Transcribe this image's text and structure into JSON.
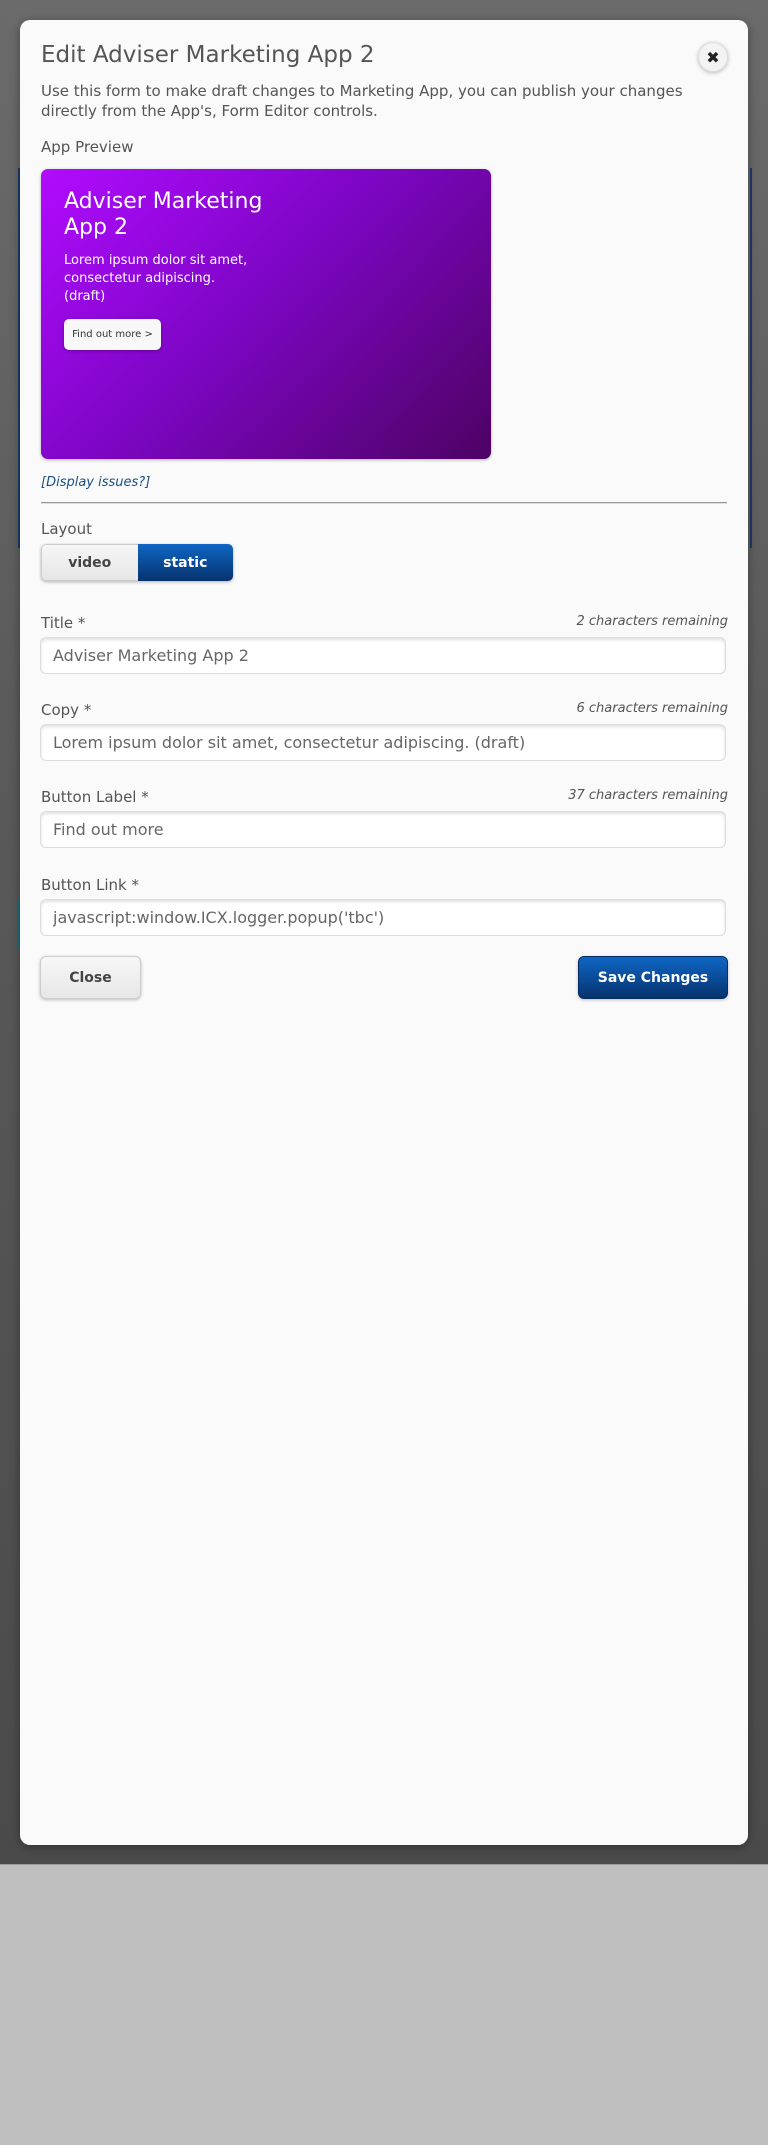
{
  "modal": {
    "title": "Edit Adviser Marketing App 2",
    "close_icon": "close-icon",
    "intro": "Use this form to make draft changes to Marketing App, you can publish your changes directly from the App's, Form Editor controls."
  },
  "preview": {
    "label": "App Preview",
    "title": "Adviser Marketing App 2",
    "copy": "Lorem ipsum dolor sit amet, consectetur adipiscing. (draft)",
    "button_label": "Find out more >",
    "display_issues": "[Display issues?]",
    "colors": {
      "gradient_start": "#b10bff",
      "gradient_end": "#4d0263"
    }
  },
  "layout": {
    "label": "Layout",
    "options": [
      "video",
      "static"
    ],
    "selected": "static"
  },
  "fields": {
    "title": {
      "label": "Title *",
      "remaining": "2 characters remaining",
      "value": "Adviser Marketing App 2"
    },
    "copy": {
      "label": "Copy *",
      "remaining": "6 characters remaining",
      "value": "Lorem ipsum dolor sit amet, consectetur adipiscing. (draft)"
    },
    "button_label": {
      "label": "Button Label *",
      "remaining": "37 characters remaining",
      "value": "Find out more"
    },
    "button_link": {
      "label": "Button Link *",
      "value": "javascript:window.ICX.logger.popup('tbc')"
    }
  },
  "actions": {
    "close_label": "Close",
    "save_label": "Save Changes"
  },
  "colors": {
    "primary": "#06336e",
    "link": "#1a4f86"
  }
}
